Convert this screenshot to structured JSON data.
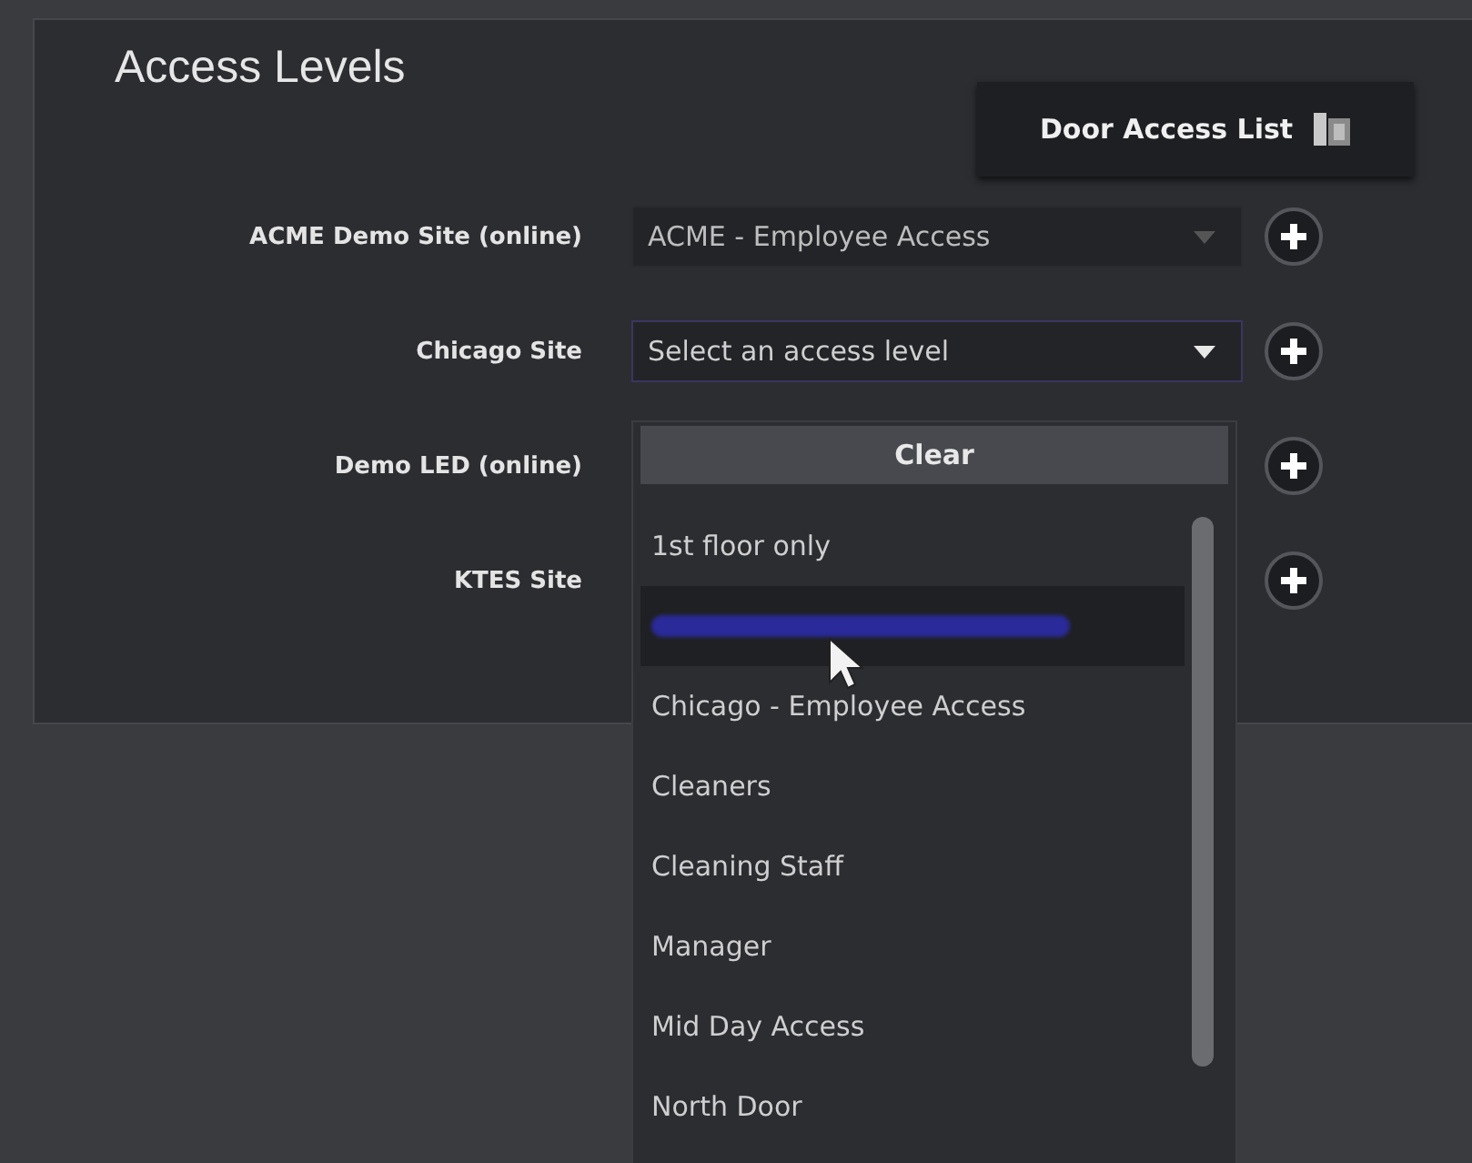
{
  "title": "Access Levels",
  "door_access_button": {
    "label": "Door Access List"
  },
  "sites": [
    {
      "label": "ACME Demo Site (online)",
      "value": "ACME - Employee Access",
      "focused": false
    },
    {
      "label": "Chicago Site",
      "placeholder": "Select an access level",
      "focused": true
    },
    {
      "label": "Demo LED (online)"
    },
    {
      "label": "KTES Site"
    }
  ],
  "dropdown": {
    "clear_label": "Clear",
    "options": [
      {
        "kind": "text",
        "label": "1st floor only",
        "selected": false
      },
      {
        "kind": "unreadable",
        "selected": true
      },
      {
        "kind": "text",
        "label": "Chicago - Employee Access",
        "selected": false
      },
      {
        "kind": "text",
        "label": "Cleaners",
        "selected": false
      },
      {
        "kind": "text",
        "label": "Cleaning Staff",
        "selected": false
      },
      {
        "kind": "text",
        "label": "Manager",
        "selected": false
      },
      {
        "kind": "text",
        "label": "Mid Day Access",
        "selected": false
      },
      {
        "kind": "text",
        "label": "North Door",
        "selected": false
      }
    ]
  }
}
